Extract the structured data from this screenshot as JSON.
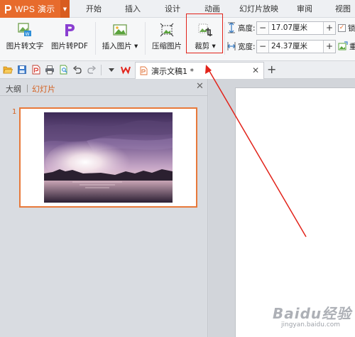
{
  "app": {
    "name": "WPS 演示"
  },
  "menu": {
    "tabs": [
      "开始",
      "插入",
      "设计",
      "动画",
      "幻灯片放映",
      "审阅",
      "视图"
    ]
  },
  "ribbon": {
    "pic_to_text": "图片转文字",
    "pic_to_pdf": "图片转PDF",
    "insert_picture": "插入图片",
    "compress_picture": "压缩图片",
    "crop": "裁剪",
    "height_label": "高度:",
    "height_value": "17.07厘米",
    "width_label": "宽度:",
    "width_value": "24.37厘米",
    "lock_label": "锁",
    "reset_label": "重"
  },
  "document": {
    "tab_title": "演示文稿1 *"
  },
  "panel": {
    "tab_outline": "大纲",
    "tab_slides": "幻灯片",
    "slide_number": "1"
  },
  "watermark": {
    "text": "Baidu经验",
    "sub": "jingyan.baidu.com"
  },
  "colors": {
    "accent": "#e76b2c",
    "annotation": "#e2231a",
    "slides_tab": "#d4601f"
  }
}
